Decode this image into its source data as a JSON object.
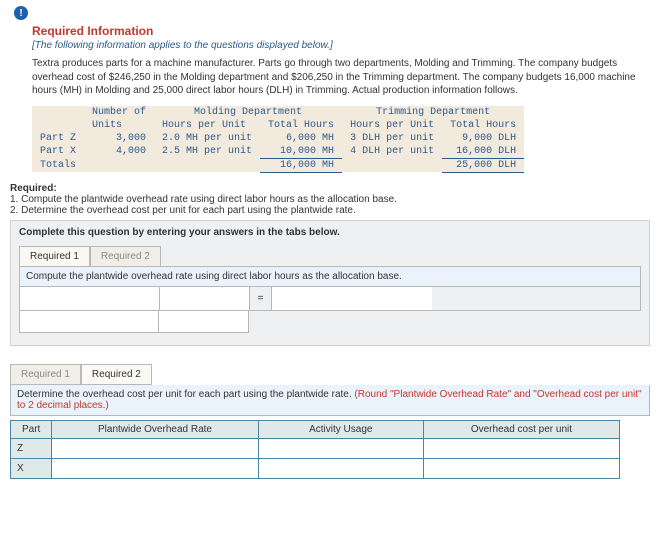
{
  "icon_glyph": "!",
  "req_title": "Required Information",
  "intro_italic": "[The following information applies to the questions displayed below.]",
  "body_text": "Textra produces parts for a machine manufacturer. Parts go through two departments, Molding and Trimming. The company budgets overhead cost of $246,250 in the Molding department and $206,250 in the Trimming department. The company budgets 16,000 machine hours (MH) in Molding and 25,000 direct labor hours (DLH) in Trimming. Actual production information follows.",
  "table": {
    "headers": {
      "num_units_a": "Number of",
      "num_units_b": "Units",
      "mold_dept": "Molding Department",
      "mold_hpu": "Hours per Unit",
      "mold_tot": "Total Hours",
      "trim_dept": "Trimming Department",
      "trim_hpu": "Hours per Unit",
      "trim_tot": "Total Hours"
    },
    "rows": [
      {
        "part": "Part Z",
        "units": "3,000",
        "m_hpu": "2.0 MH per unit",
        "m_tot": "6,000 MH",
        "t_hpu": "3 DLH per unit",
        "t_tot": "9,000 DLH"
      },
      {
        "part": "Part X",
        "units": "4,000",
        "m_hpu": "2.5 MH per unit",
        "m_tot": "10,000 MH",
        "t_hpu": "4 DLH per unit",
        "t_tot": "16,000 DLH"
      }
    ],
    "totals": {
      "label": "Totals",
      "m_tot": "16,000 MH",
      "t_tot": "25,000 DLH"
    }
  },
  "required_block": {
    "title": "Required:",
    "item1": "1. Compute the plantwide overhead rate using direct labor hours as the allocation base.",
    "item2": "2. Determine the overhead cost per unit for each part using the plantwide rate."
  },
  "tabs_lead": "Complete this question by entering your answers in the tabs below.",
  "tab1": "Required 1",
  "tab2": "Required 2",
  "prompt1": "Compute the plantwide overhead rate using direct labor hours as the allocation base.",
  "eq": "=",
  "prompt2_a": "Determine the overhead cost per unit for each part using the plantwide rate. ",
  "prompt2_b": "(Round \"Plantwide Overhead Rate\" and \"Overhead cost per unit\" to 2 decimal places.)",
  "ans_headers": {
    "part": "Part",
    "rate": "Plantwide Overhead Rate",
    "usage": "Activity Usage",
    "cost": "Overhead cost per unit"
  },
  "ans_rows": [
    {
      "part": "Z"
    },
    {
      "part": "X"
    }
  ]
}
